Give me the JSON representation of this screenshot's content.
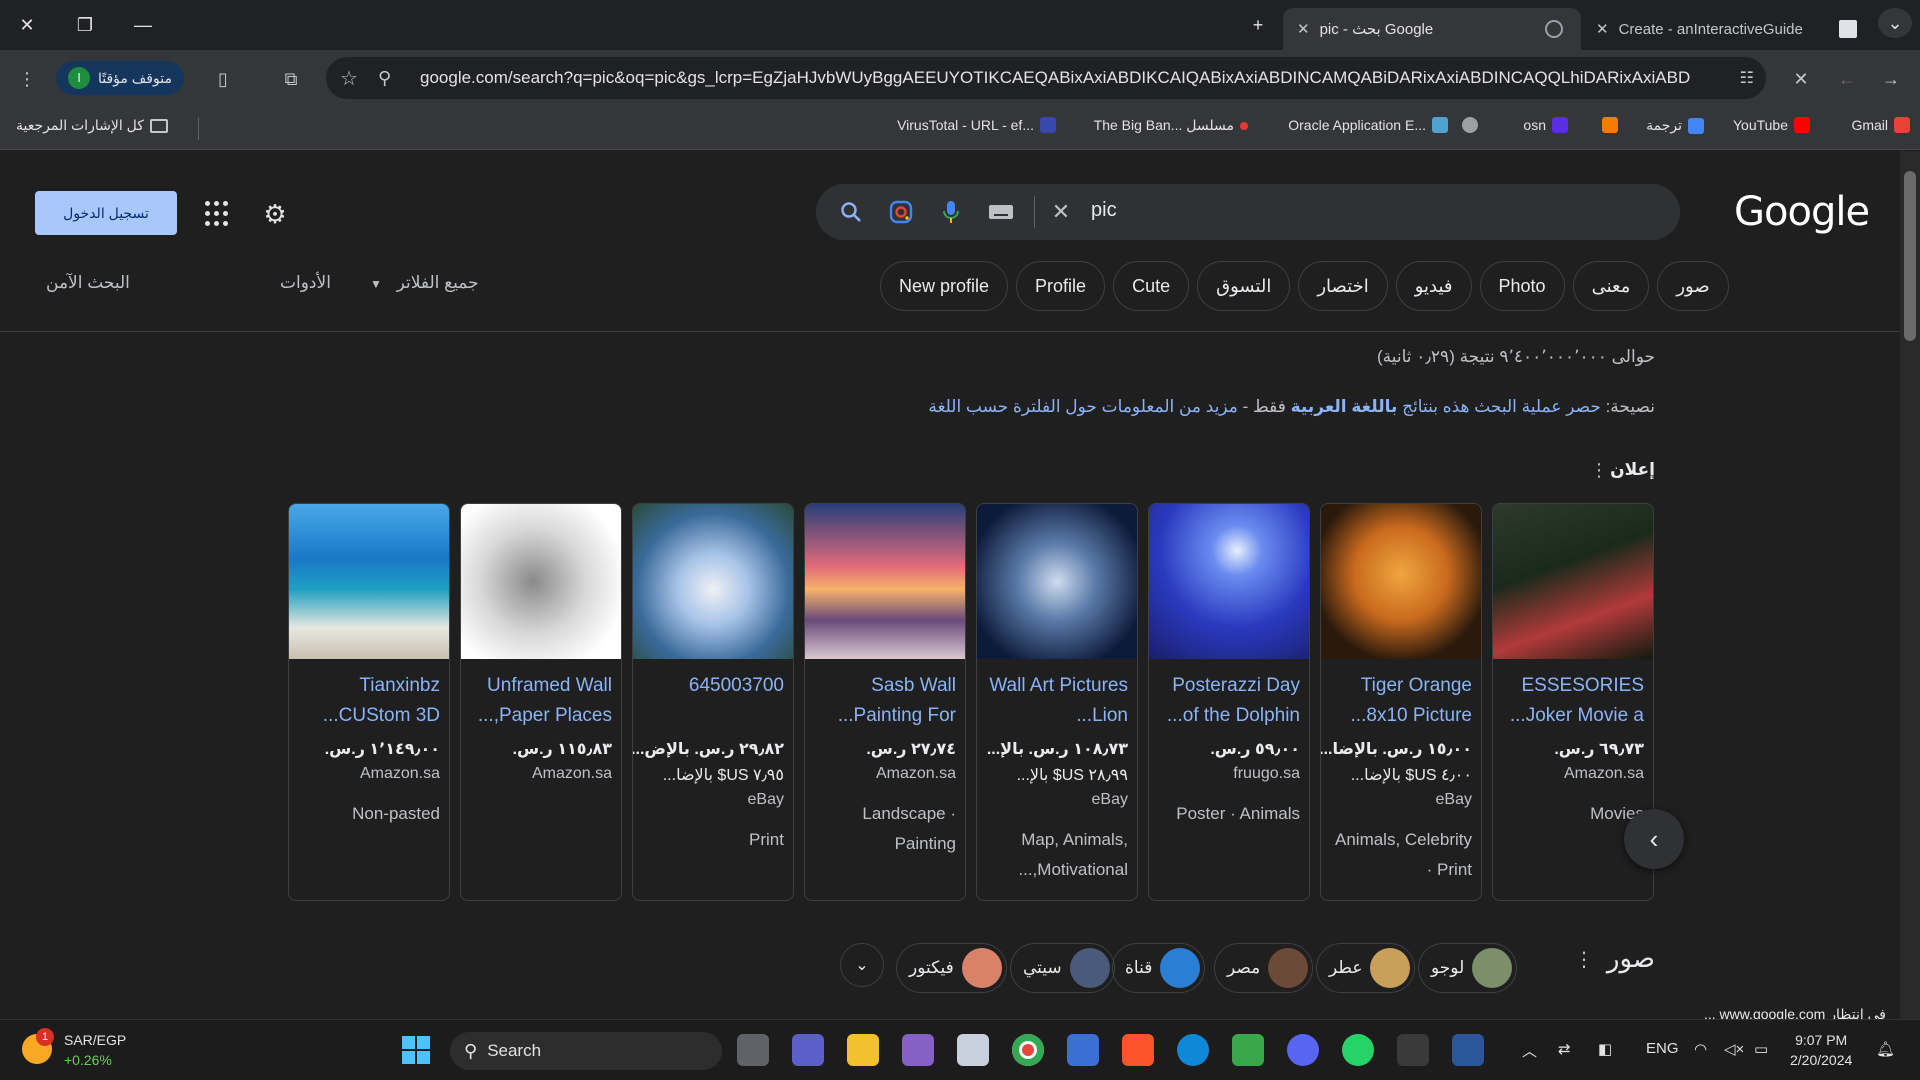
{
  "browser": {
    "tabs": [
      {
        "title": "pic - بحث Google",
        "active": true
      },
      {
        "title": "Create - anInteractiveGuide",
        "active": false
      }
    ],
    "profile_status": "متوقف مؤقتًا",
    "profile_initial": "ا",
    "url": "google.com/search?q=pic&oq=pic&gs_lcrp=EgZjaHJvbWUyBggAEEUYOTIKCAEQABixAxiABDIKCAIQABixAxiABDINCAMQABiDARixAxiABDINCAQQLhiDARixAxiABDIGCA...",
    "bookmarks": [
      {
        "label": "Gmail",
        "color": "#ea4335"
      },
      {
        "label": "YouTube",
        "color": "#ff0000"
      },
      {
        "label": "ترجمة",
        "color": "#4285f4"
      },
      {
        "label": "",
        "color": "#f57c00"
      },
      {
        "label": "osn",
        "color": "#5b2ee0"
      },
      {
        "label": "",
        "color": "#9aa0a6"
      },
      {
        "label": "Oracle Application E...",
        "color": "#4fa3d1"
      },
      {
        "label": "The Big Ban... مسلسل",
        "color": "#e53935"
      },
      {
        "label": "VirusTotal - URL - ef...",
        "color": "#3949ab"
      }
    ],
    "all_bookmarks": "كل الإشارات المرجعية"
  },
  "google": {
    "logo": "Google",
    "query": "pic",
    "signin_label": "تسجيل الدخول",
    "chips": [
      "صور",
      "معنى",
      "Photo",
      "فيديو",
      "اختصار",
      "التسوق",
      "Cute",
      "Profile",
      "New profile"
    ],
    "filters": {
      "all": "جميع الفلاتر",
      "tools": "الأدوات",
      "safe": "البحث الآمن"
    },
    "stats": "حوالى ٩٬٤٠٠٬٠٠٠٬٠٠٠ نتيجة (٠٫٢٩ ثانية)",
    "tip_prefix": "نصيحة:",
    "tip_link1": "حصر عملية البحث هذه بنتائج",
    "tip_bold": "باللغة العربية",
    "tip_mid": "فقط -",
    "tip_link2": "مزيد من المعلومات حول الفلترة حسب اللغة",
    "ad_label": "إعلان",
    "products": [
      {
        "title": "ESSESORIES Joker Movie a...",
        "price": "٦٩٫٧٣ ر.س.",
        "ship": "",
        "store": "Amazon.sa",
        "cat": "Movies",
        "img": "joker"
      },
      {
        "title": "Tiger Orange 8x10 Picture...",
        "price": "١٥٫٠٠ ر.س. بالإضا...",
        "ship": "٤٫٠٠ US$ بالإضا...",
        "store": "eBay",
        "cat": "Animals, Celebrity · Print",
        "img": "tiger"
      },
      {
        "title": "Posterazzi Day of the Dolphin...",
        "price": "٥٩٫٠٠ ر.س.",
        "ship": "",
        "store": "fruugo.sa",
        "cat": "Poster · Animals",
        "img": "dolphin"
      },
      {
        "title": "Wall Art Pictures Lion...",
        "price": "١٠٨٫٧٣ ر.س. بالإ...",
        "ship": "٢٨٫٩٩ US$ بالإ...",
        "store": "eBay",
        "cat": "Map, Animals, Motivational,...",
        "img": "lion"
      },
      {
        "title": "Sasb Wall Painting For...",
        "price": "٢٧٫٧٤ ر.س.",
        "ship": "",
        "store": "Amazon.sa",
        "cat": "Landscape · Painting",
        "img": "sunset"
      },
      {
        "title": "645003700",
        "price": "٢٩٫٨٢ ر.س. بالإض...",
        "ship": "٧٫٩٥ US$ بالإضا...",
        "store": "eBay",
        "cat": "Print",
        "img": "bunny"
      },
      {
        "title": "Unframed Wall Paper Places,...",
        "price": "١١٥٫٨٣ ر.س.",
        "ship": "",
        "store": "Amazon.sa",
        "cat": "",
        "img": "tree"
      },
      {
        "title": "Tianxinbz CUStom 3D...",
        "price": "١٬١٤٩٫٠٠ ر.س.",
        "ship": "",
        "store": "Amazon.sa",
        "cat": "Non-pasted",
        "img": "beach"
      }
    ],
    "images_title": "صور",
    "image_chips": [
      {
        "label": "لوجو",
        "color": "#7a8f6a"
      },
      {
        "label": "عطر",
        "color": "#c9a05a"
      },
      {
        "label": "مصر",
        "color": "#6b4a3a"
      },
      {
        "label": "قناة",
        "color": "#2a7fd4"
      },
      {
        "label": "سيتي",
        "color": "#4a5a7a"
      },
      {
        "label": "فيكتور",
        "color": "#d9826a"
      }
    ],
    "status_bar": "في انتظار www.google.com ..."
  },
  "taskbar": {
    "stock_symbol": "SAR/EGP",
    "stock_change": "+0.26%",
    "stock_badge": "1",
    "search_label": "Search",
    "language": "ENG",
    "time": "9:07 PM",
    "date": "2/20/2024"
  }
}
